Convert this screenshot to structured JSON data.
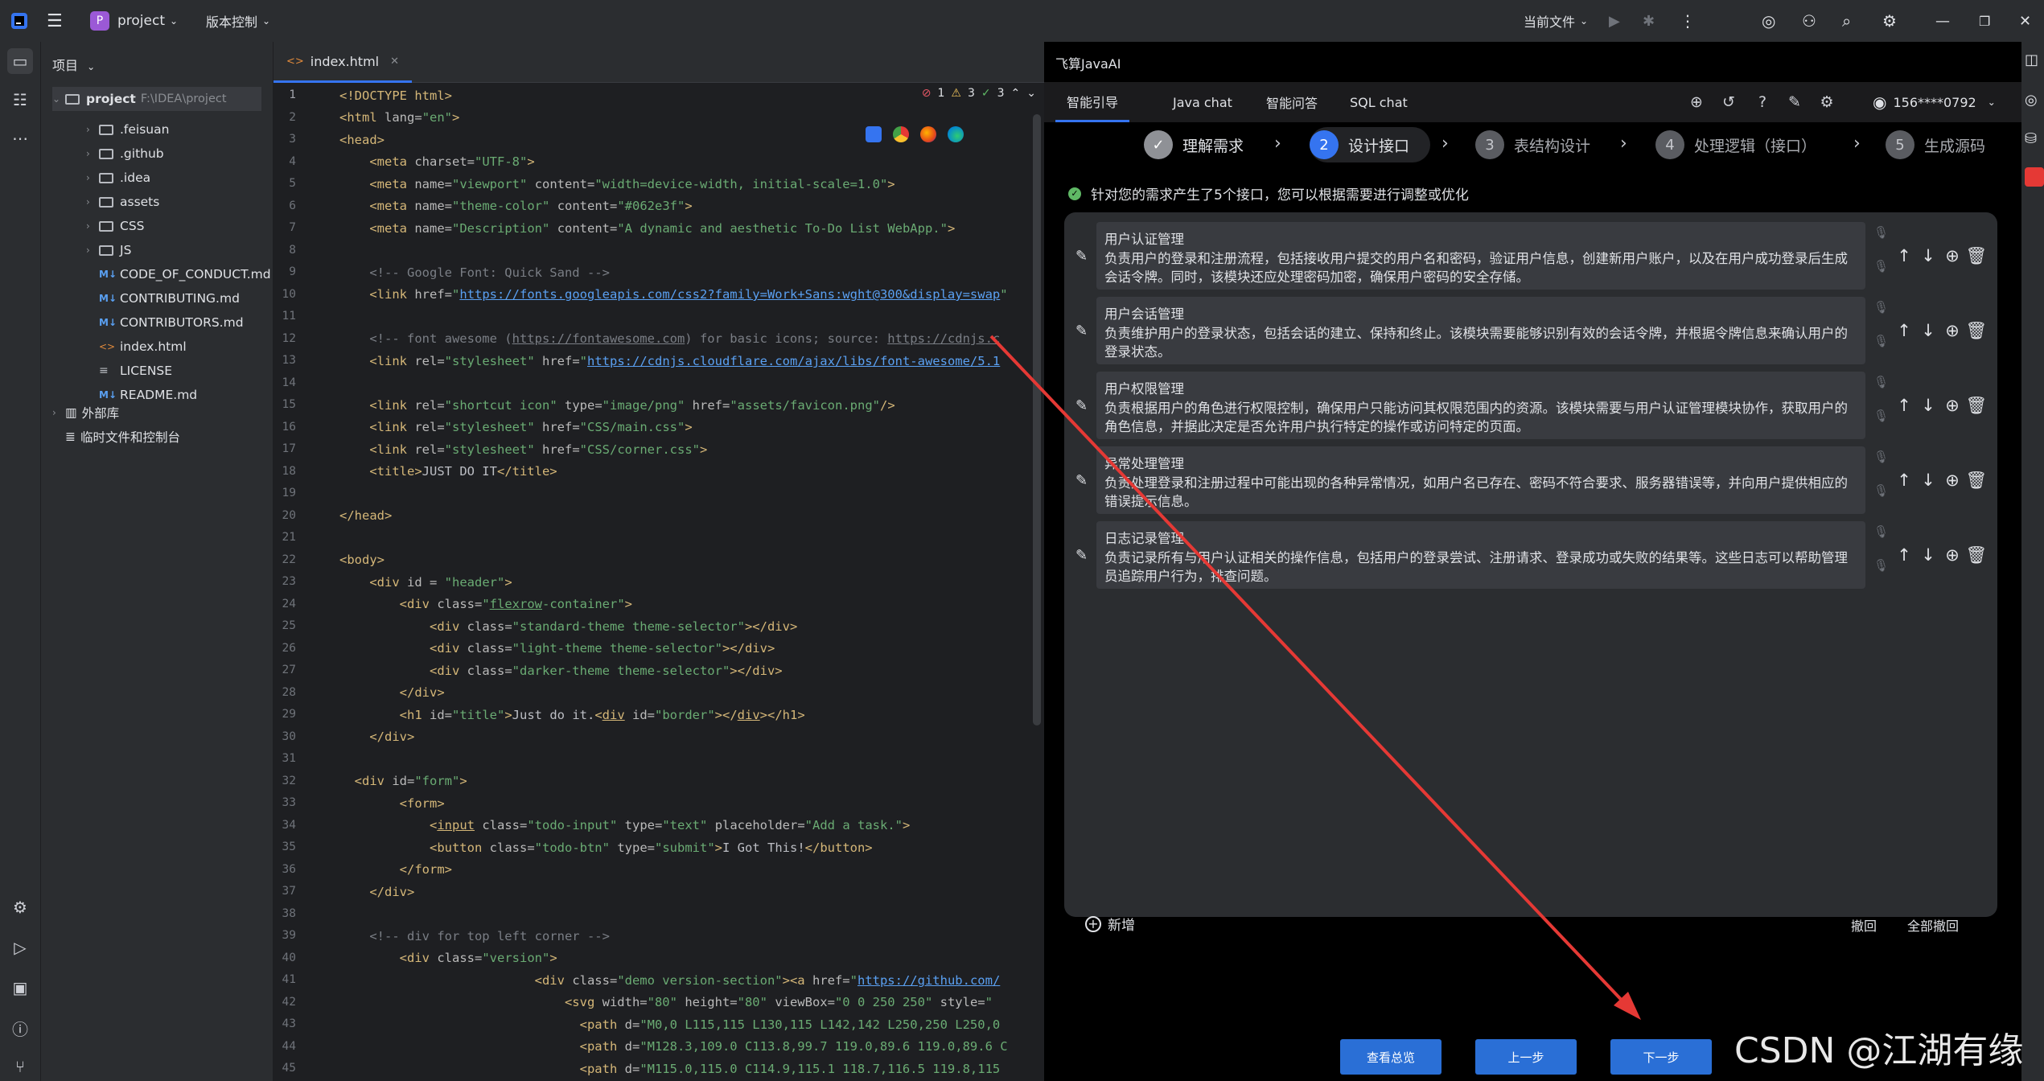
{
  "titlebar": {
    "project_badge": "P",
    "project_name": "project",
    "vcs": "版本控制",
    "run_target": "当前文件"
  },
  "project_panel": {
    "header": "项目",
    "root_name": "project",
    "root_path": "F:\\IDEA\\project",
    "items": [
      {
        "label": ".feisuan",
        "kind": "folder"
      },
      {
        "label": ".github",
        "kind": "folder"
      },
      {
        "label": ".idea",
        "kind": "folder"
      },
      {
        "label": "assets",
        "kind": "folder"
      },
      {
        "label": "CSS",
        "kind": "folder"
      },
      {
        "label": "JS",
        "kind": "folder"
      },
      {
        "label": "CODE_OF_CONDUCT.md",
        "kind": "md"
      },
      {
        "label": "CONTRIBUTING.md",
        "kind": "md"
      },
      {
        "label": "CONTRIBUTORS.md",
        "kind": "md"
      },
      {
        "label": "index.html",
        "kind": "html"
      },
      {
        "label": "LICENSE",
        "kind": "txt"
      },
      {
        "label": "README.md",
        "kind": "md"
      }
    ],
    "external_libs": "外部库",
    "scratches": "临时文件和控制台"
  },
  "editor": {
    "tab_label": "index.html",
    "inspections": {
      "errors": "1",
      "warnings": "3",
      "ok": "3"
    },
    "md_badge": "M↓",
    "html_badge": "<>"
  },
  "ai_panel": {
    "title": "飞算JavaAI",
    "tabs": [
      "智能引导",
      "Java chat",
      "智能问答",
      "SQL chat"
    ],
    "account": "156****0792",
    "steps": [
      {
        "num": "✓",
        "label": "理解需求",
        "state": "done"
      },
      {
        "num": "2",
        "label": "设计接口",
        "state": "active"
      },
      {
        "num": "3",
        "label": "表结构设计",
        "state": "todo"
      },
      {
        "num": "4",
        "label": "处理逻辑（接口）",
        "state": "todo"
      },
      {
        "num": "5",
        "label": "生成源码",
        "state": "todo"
      }
    ],
    "notice": "针对您的需求产生了5个接口，您可以根据需要进行调整或优化",
    "interfaces": [
      {
        "name": "用户认证管理",
        "desc": "负责用户的登录和注册流程，包括接收用户提交的用户名和密码，验证用户信息，创建新用户账户，以及在用户成功登录后生成会话令牌。同时，该模块还应处理密码加密，确保用户密码的安全存储。"
      },
      {
        "name": "用户会话管理",
        "desc": "负责维护用户的登录状态，包括会话的建立、保持和终止。该模块需要能够识别有效的会话令牌，并根据令牌信息来确认用户的登录状态。"
      },
      {
        "name": "用户权限管理",
        "desc": "负责根据用户的角色进行权限控制，确保用户只能访问其权限范围内的资源。该模块需要与用户认证管理模块协作，获取用户的角色信息，并据此决定是否允许用户执行特定的操作或访问特定的页面。"
      },
      {
        "name": "异常处理管理",
        "desc": "负责处理登录和注册过程中可能出现的各种异常情况，如用户名已存在、密码不符合要求、服务器错误等，并向用户提供相应的错误提示信息。"
      },
      {
        "name": "日志记录管理",
        "desc": "负责记录所有与用户认证相关的操作信息，包括用户的登录尝试、注册请求、登录成功或失败的结果等。这些日志可以帮助管理员追踪用户行为，排查问题。"
      }
    ],
    "add_label": "新增",
    "undo_label": "撤回",
    "undo_all_label": "全部撤回",
    "buttons": {
      "overview": "查看总览",
      "prev": "上一步",
      "next": "下一步"
    }
  },
  "watermark": "CSDN @江湖有缘",
  "colors": {
    "accent": "#3574f0",
    "arrow": "#e53935"
  }
}
